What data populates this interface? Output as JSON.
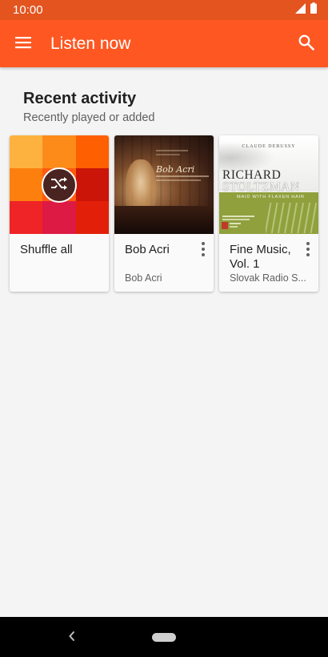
{
  "status_bar": {
    "time": "10:00",
    "icons": [
      "signal-icon",
      "battery-icon"
    ]
  },
  "app_bar": {
    "title": "Listen now",
    "menu_icon": "hamburger-menu-icon",
    "search_icon": "search-icon",
    "color": "#fe5722"
  },
  "section": {
    "title": "Recent activity",
    "subtitle": "Recently played or added"
  },
  "cards": [
    {
      "title": "Shuffle all",
      "subtitle": "",
      "art": "shuffle-mosaic",
      "badge_icon": "shuffle-icon",
      "mosaic_colors": [
        "#fdb23f",
        "#fd8b1a",
        "#fe5f00",
        "#fd800f",
        "#fe5b0f",
        "#ca1508",
        "#ef2427",
        "#dd1a44",
        "#e2200a"
      ]
    },
    {
      "title": "Bob Acri",
      "subtitle": "Bob Acri",
      "art": "bob-acri-cover",
      "art_text": "Bob Acri",
      "menu_icon": "more-vert-icon"
    },
    {
      "title": "Fine Music, Vol. 1",
      "subtitle": "Slovak Radio S...",
      "art": "richard-stoltzman-cover",
      "art_text": {
        "composer": "CLAUDE DEBUSSY",
        "line1": "RICHARD",
        "line2": "STOLTZMAN",
        "subtitle": "MAID WITH FLAXEN HAIR"
      },
      "menu_icon": "more-vert-icon"
    }
  ],
  "nav_bar": {
    "back_icon": "back-chevron-icon",
    "home_icon": "home-pill-icon"
  }
}
